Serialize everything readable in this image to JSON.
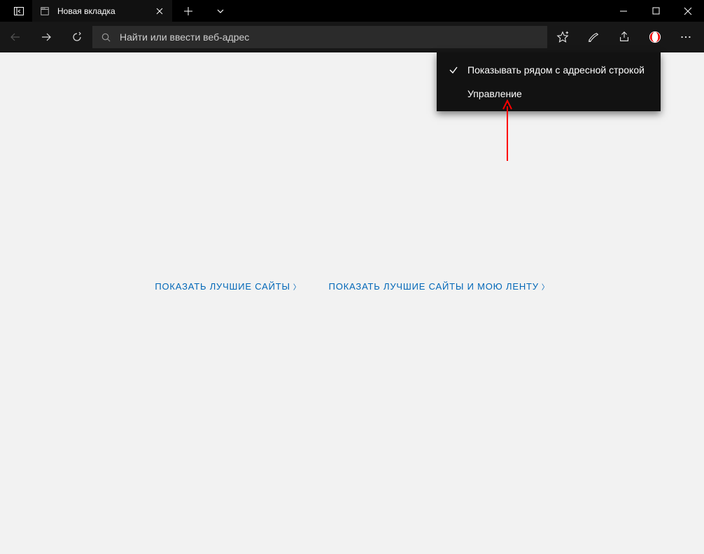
{
  "tab": {
    "title": "Новая вкладка"
  },
  "toolbar": {
    "address_placeholder": "Найти или ввести веб-адрес"
  },
  "dropdown": {
    "item_show_near_addr": "Показывать рядом с адресной строкой",
    "item_manage": "Управление"
  },
  "content": {
    "link_top_sites": "ПОКАЗАТЬ ЛУЧШИЕ САЙТЫ",
    "link_top_sites_feed": "ПОКАЗАТЬ ЛУЧШИЕ САЙТЫ И МОЮ ЛЕНТУ"
  }
}
